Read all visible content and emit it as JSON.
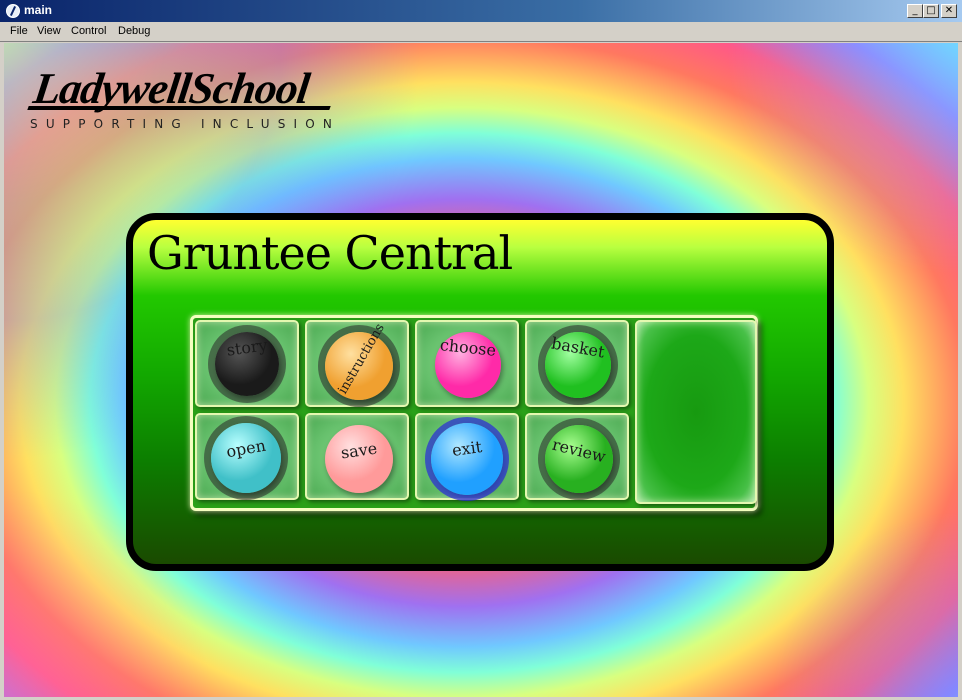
{
  "window": {
    "title": "main",
    "minimize_label": "_",
    "maximize_label": "□",
    "close_label": "✕"
  },
  "menu": [
    "File",
    "View",
    "Control",
    "Debug"
  ],
  "logo": {
    "main": "LadywellSchool",
    "sub": "SUPPORTING INCLUSION"
  },
  "panel": {
    "title": "Gruntee Central",
    "buttons": [
      {
        "label": "story",
        "color": "#1a1a1a",
        "highlight": "#555555"
      },
      {
        "label": "instructions",
        "color": "#f0a030",
        "highlight": "#ffe0a0"
      },
      {
        "label": "choose",
        "color": "#ff2aa8",
        "highlight": "#ffb0e0"
      },
      {
        "label": "basket",
        "color": "#20c020",
        "highlight": "#a0ffa0"
      },
      {
        "label": "open",
        "color": "#40c0c8",
        "highlight": "#b8ffff"
      },
      {
        "label": "save",
        "color": "#ff9a9a",
        "highlight": "#ffe0e0"
      },
      {
        "label": "exit",
        "color": "#20a0ff",
        "highlight": "#b0e8ff"
      },
      {
        "label": "review",
        "color": "#28b020",
        "highlight": "#a8ff90"
      }
    ]
  }
}
